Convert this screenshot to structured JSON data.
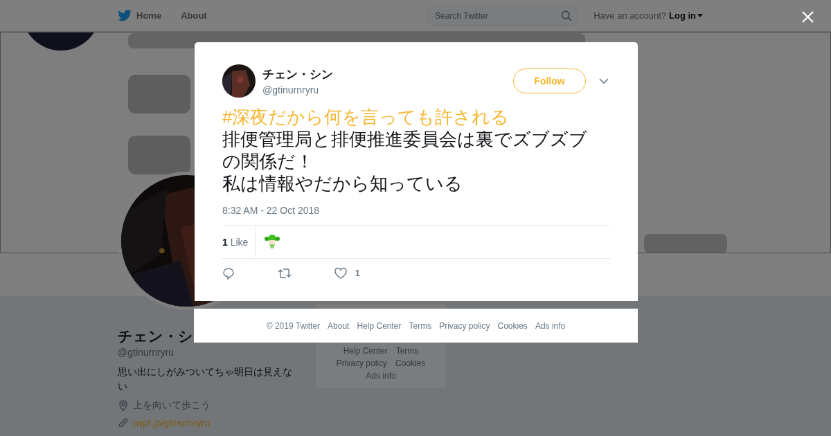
{
  "topbar": {
    "nav": [
      {
        "label": "Home"
      },
      {
        "label": "About"
      }
    ],
    "search": {
      "placeholder": "Search Twitter"
    },
    "account_prompt": "Have an account?",
    "login": "Log in"
  },
  "profile": {
    "name": "チェン・シ",
    "handle": "@gtinurnryru",
    "bio": "思い出にしがみついてちゃ明日は見えない",
    "location": "上を向いて歩こう",
    "url": "twpf.jp/gtinurnryru"
  },
  "side_footer": [
    "Help Center",
    "Terms",
    "Privacy policy",
    "Cookies",
    "Ads info"
  ],
  "tweet": {
    "name": "チェン・シン",
    "handle": "@gtinurnryru",
    "follow": "Follow",
    "hashtag": "#深夜だから何を言っても許される",
    "paragraphs": [
      "排便管理局と排便推進委員会は裏でズブズブの関係だ！",
      "私は情報やだから知っている"
    ],
    "timestamp": "8:32 AM - 22 Oct 2018",
    "likes_label": "**1** Like",
    "like_count": "1"
  },
  "modal_footer": [
    "© 2019 Twitter",
    "About",
    "Help Center",
    "Terms",
    "Privacy policy",
    "Cookies",
    "Ads info"
  ]
}
